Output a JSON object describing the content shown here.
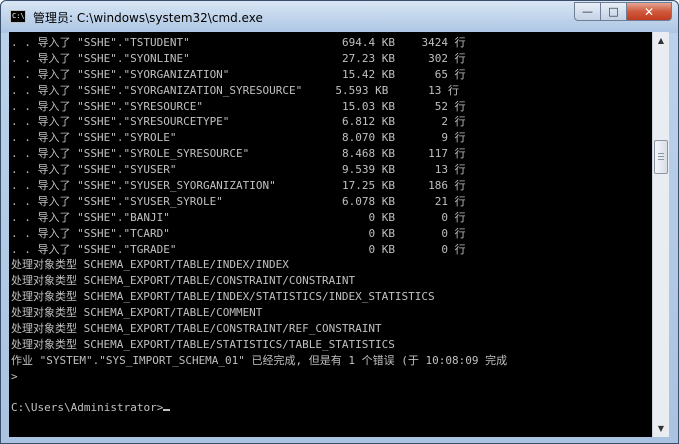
{
  "window": {
    "title": "管理员: C:\\windows\\system32\\cmd.exe",
    "icon": "cmd-console-icon",
    "icon_text": "C:\\"
  },
  "caption_buttons": {
    "minimize_icon": "minimize-icon",
    "maximize_icon": "maximize-icon",
    "close_icon": "close-icon",
    "minimize_glyph": "—",
    "maximize_glyph": "□",
    "close_glyph": "✕"
  },
  "console": {
    "lines": [
      ". . 导入了 \"SSHE\".\"TSTUDENT\"                       694.4 KB    3424 行",
      ". . 导入了 \"SSHE\".\"SYONLINE\"                       27.23 KB     302 行",
      ". . 导入了 \"SSHE\".\"SYORGANIZATION\"                 15.42 KB      65 行",
      ". . 导入了 \"SSHE\".\"SYORGANIZATION_SYRESOURCE\"     5.593 KB      13 行",
      ". . 导入了 \"SSHE\".\"SYRESOURCE\"                     15.03 KB      52 行",
      ". . 导入了 \"SSHE\".\"SYRESOURCETYPE\"                 6.812 KB       2 行",
      ". . 导入了 \"SSHE\".\"SYROLE\"                         8.070 KB       9 行",
      ". . 导入了 \"SSHE\".\"SYROLE_SYRESOURCE\"              8.468 KB     117 行",
      ". . 导入了 \"SSHE\".\"SYUSER\"                         9.539 KB      13 行",
      ". . 导入了 \"SSHE\".\"SYUSER_SYORGANIZATION\"          17.25 KB     186 行",
      ". . 导入了 \"SSHE\".\"SYUSER_SYROLE\"                  6.078 KB      21 行",
      ". . 导入了 \"SSHE\".\"BANJI\"                              0 KB       0 行",
      ". . 导入了 \"SSHE\".\"TCARD\"                              0 KB       0 行",
      ". . 导入了 \"SSHE\".\"TGRADE\"                             0 KB       0 行",
      "处理对象类型 SCHEMA_EXPORT/TABLE/INDEX/INDEX",
      "处理对象类型 SCHEMA_EXPORT/TABLE/CONSTRAINT/CONSTRAINT",
      "处理对象类型 SCHEMA_EXPORT/TABLE/INDEX/STATISTICS/INDEX_STATISTICS",
      "处理对象类型 SCHEMA_EXPORT/TABLE/COMMENT",
      "处理对象类型 SCHEMA_EXPORT/TABLE/CONSTRAINT/REF_CONSTRAINT",
      "处理对象类型 SCHEMA_EXPORT/TABLE/STATISTICS/TABLE_STATISTICS",
      "作业 \"SYSTEM\".\"SYS_IMPORT_SCHEMA_01\" 已经完成, 但是有 1 个错误 (于 10:08:09 完成",
      ">",
      "",
      "C:\\Users\\Administrator>"
    ]
  },
  "scrollbar": {
    "up_glyph": "▲",
    "down_glyph": "▼",
    "position_fraction": 0.27
  }
}
